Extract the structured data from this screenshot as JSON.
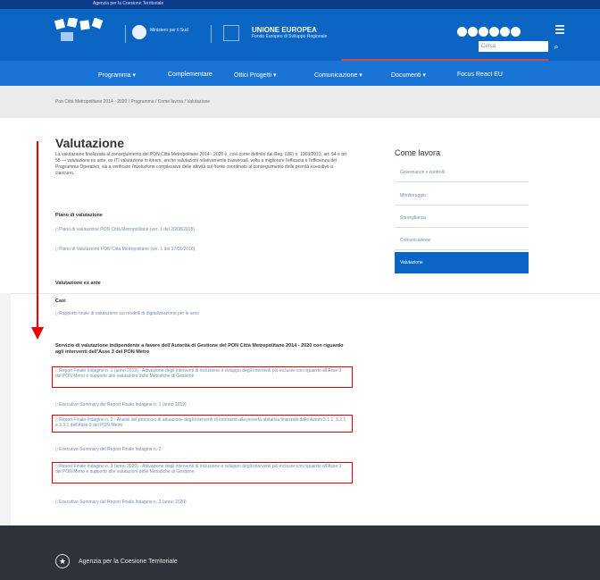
{
  "header": {
    "agency_strip": "Agenzia per la Coesione Territoriale",
    "eu_title": "UNIONE EUROPEA",
    "eu_sub": "Fondo Europeo di Sviluppo Regionale",
    "ministry": "Ministero per il Sud",
    "search_placeholder": "Cerca",
    "search_icon": "search-icon"
  },
  "nav": {
    "items": [
      "Programma ▾",
      "Complementare",
      "Ottici Progetti ▾",
      "Comunicazione ▾",
      "Documenti ▾",
      "Focus React EU"
    ]
  },
  "breadcrumb": "Pon Città Metropolitane 2014 - 2020 / Programma / Come lavora / Valutazione",
  "main": {
    "title": "Valutazione",
    "intro": "La valutazione finalizzata al conseguimento dei PON Città Metropolitane 2014 - 2020 è, così come definito dal Reg. (UE) n. 1303/2013, art. 54 e art 55 — valutazione ex ante, ex ITI valutazione in itinere, anche valutazioni relativamente trasversali, volta a migliorare l'efficacia e l'efficienza del Programma Operativo, sia a verificare l'evoluzione complessiva delle attività sul fronte coordinato al conseguimento delle priorità esecutivo a ciascuno.",
    "plans_head": "Piano di valutazione",
    "plans": [
      "Piano di valutazione PON Città Metropolitane (ver. 1 del 20/08/2018)",
      "Piano di Valutazione PON Città Metropolitane (ver. 1 del 17/01/2018)"
    ],
    "exante_head": "Valutazione ex ante",
    "casi_head": "Casi",
    "casi": [
      "Rapporto finale di valutazione sui modelli di digitalizzazione per le aree"
    ],
    "service_head": "Servizio di valutazione indipendente a favore dell'Autorità di Gestione del PON Città Metropolitane 2014 - 2020 con riguardo agli interventi dell'Asse 3 del PON Metro",
    "reports": [
      "Report Finale Indagine n. 1 (anno 2019) - Attivazione degli interventi di inclusione e sviluppo degli interventi più inclusivi con riguardo all'Asse 3 del PON Metro e supporto alle valutazioni delle Metodiche di Gestione",
      "Executive Summary del Report Finale Indagine n. 1 (anno 2019)",
      "Report Finale Indagine n. 2 - Analisi del processo di attuazione degli interventi di contrasto alla povertà abitativa finanziati dalle Azioni 3.1.1, 3.2.1 e 3.3.1 dell'Asse 3 del PON Metro",
      "Executive Summary del Report Finale Indagine n. 2",
      "Report Finale Indagine n. 3 (anno 2020) - Attivazione degli interventi di inclusione e sviluppo degli interventi più inclusivi con riguardo all'Asse 3 del PON Metro e supporto alle valutazioni delle Metodiche di Gestione",
      "Executive Summary del Report Finale Indagine n. 3 (anno 2020)"
    ]
  },
  "sidebar": {
    "title": "Come lavora",
    "items": [
      "Governance e controlli",
      "Monitoraggio",
      "Sorveglianza",
      "Comunicazione",
      "Valutazione"
    ]
  },
  "footer": {
    "agency": "Agenzia per la Coesione Territoriale"
  },
  "colors": {
    "header_blue": "#0b66c3",
    "nav_blue": "#1a74d6",
    "annotation_red": "#e00000",
    "footer_dark": "#2d3338"
  }
}
